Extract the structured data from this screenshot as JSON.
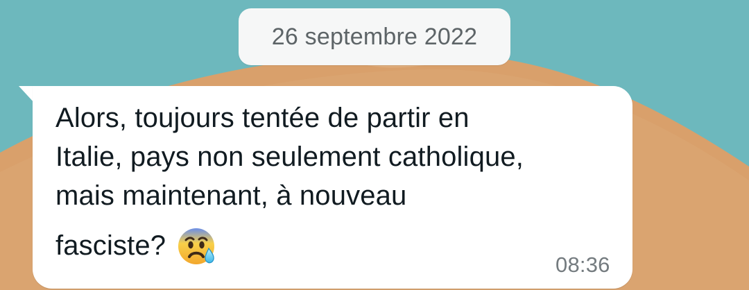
{
  "chat": {
    "date_label": "26 septembre 2022",
    "message": {
      "lines": [
        "Alors, toujours tentée de partir en",
        "Italie, pays non seulement catholique,",
        "mais maintenant, à nouveau",
        "fasciste?"
      ],
      "emoji_icon": "anxious-face-with-sweat-icon",
      "time": "08:36"
    }
  },
  "colors": {
    "wallpaper_sky": "#6db8bd",
    "wallpaper_dune": "#d9a06b",
    "date_chip": "#f6f7f7",
    "bubble": "#ffffff",
    "message_text": "#111b21",
    "meta_text": "#747b7f"
  }
}
